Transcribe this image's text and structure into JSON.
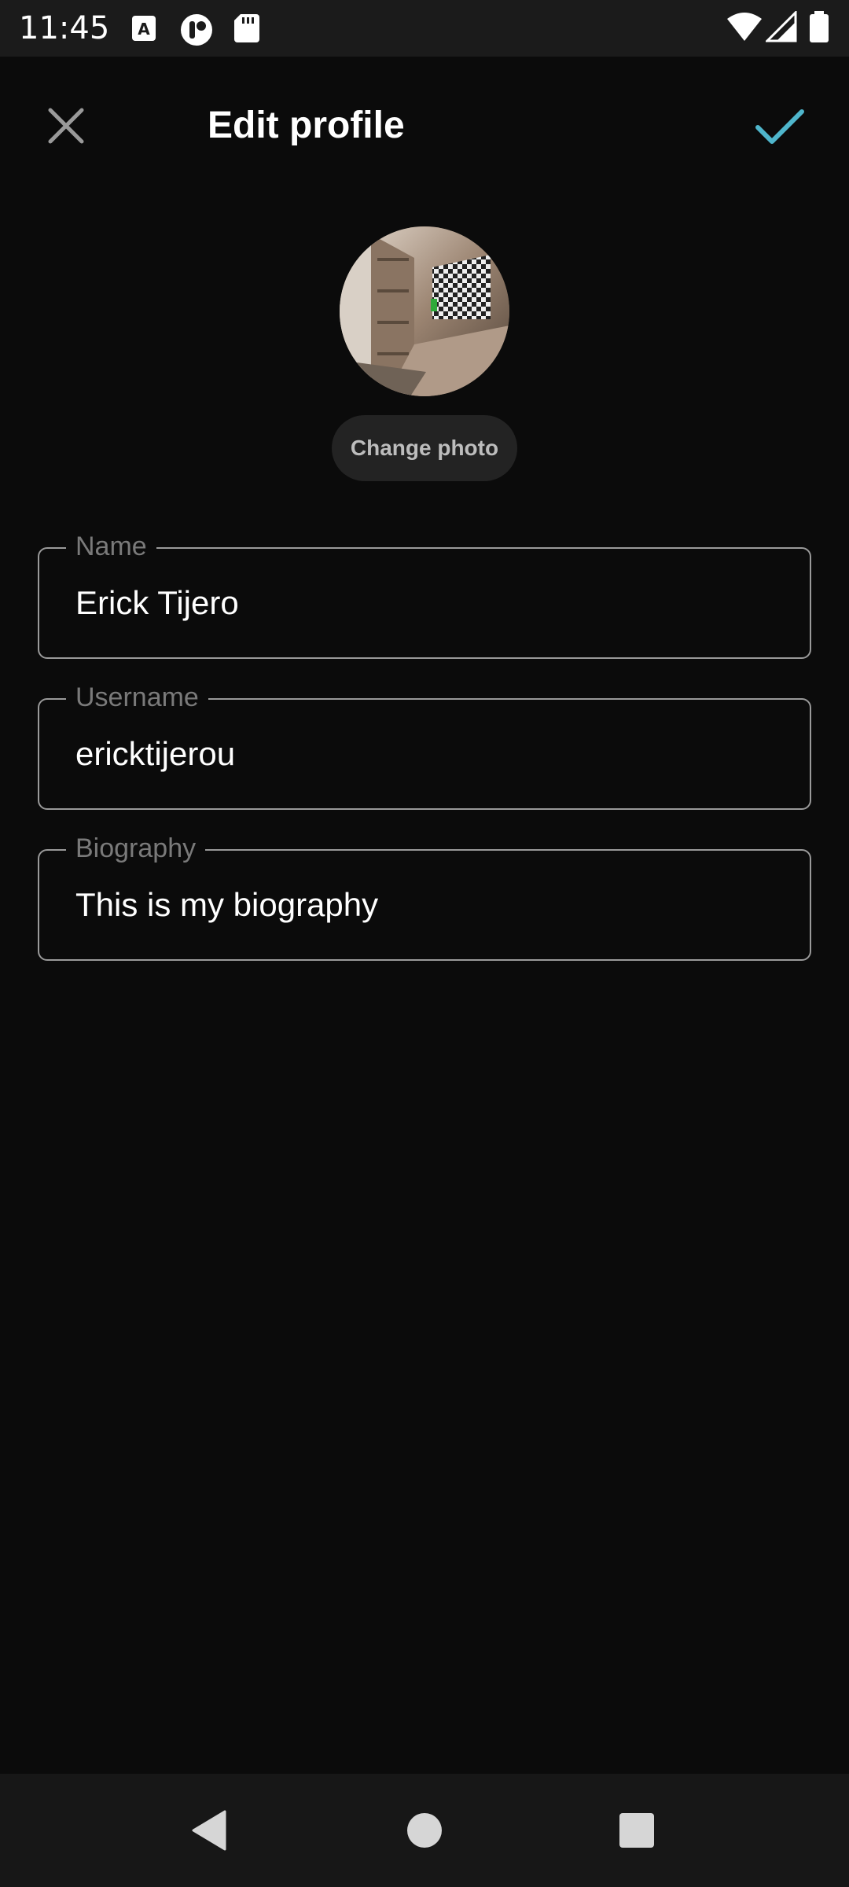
{
  "theme": {
    "background": "#0b0b0b",
    "accent": "#4fb6cc"
  },
  "status_bar": {
    "time": "11:45",
    "left_icons": [
      "font-icon",
      "app-icon",
      "sd-card-icon"
    ],
    "right_icons": [
      "wifi-icon",
      "cell-signal-icon",
      "battery-icon"
    ]
  },
  "header": {
    "title": "Edit profile",
    "close_icon": "close-icon",
    "save_icon": "check-icon"
  },
  "profile": {
    "change_photo_label": "Change photo"
  },
  "form": {
    "name": {
      "label": "Name",
      "value": "Erick Tijero"
    },
    "username": {
      "label": "Username",
      "value": "ericktijerou"
    },
    "biography": {
      "label": "Biography",
      "value": "This is my biography"
    }
  },
  "nav": [
    "back-icon",
    "home-icon",
    "recents-icon"
  ]
}
